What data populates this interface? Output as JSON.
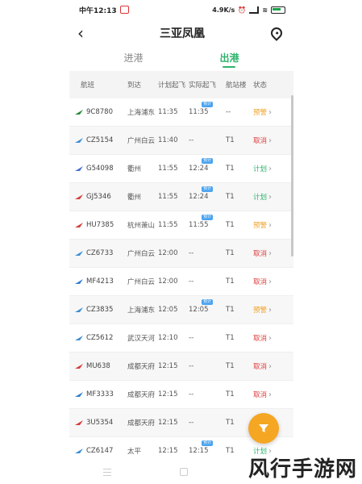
{
  "status_bar": {
    "time": "中午12:13",
    "speed": "4.9K/s",
    "battery_color": "#1aa34a"
  },
  "header": {
    "title": "三亚凤凰"
  },
  "tabs": [
    {
      "label": "进港",
      "active": false
    },
    {
      "label": "出港",
      "active": true
    }
  ],
  "table": {
    "headers": [
      "航班",
      "到达",
      "计划起飞",
      "实际起飞",
      "航站楼",
      "状态"
    ],
    "rows": [
      {
        "flight": "9C8780",
        "dest": "上海浦东",
        "plan": "11:35",
        "actual": "11:35",
        "tag": "预计",
        "terminal": "--",
        "status": "预警",
        "status_type": "pre",
        "logo_color": "#2a8a3a"
      },
      {
        "flight": "CZ5154",
        "dest": "广州白云",
        "plan": "11:40",
        "actual": "--",
        "tag": "",
        "terminal": "T1",
        "status": "取消",
        "status_type": "cancel",
        "logo_color": "#3b8fd6"
      },
      {
        "flight": "G54098",
        "dest": "衢州",
        "plan": "11:55",
        "actual": "12:24",
        "tag": "预计",
        "terminal": "T1",
        "status": "计划",
        "status_type": "plan",
        "logo_color": "#4a6fd6"
      },
      {
        "flight": "GJ5346",
        "dest": "衢州",
        "plan": "11:55",
        "actual": "12:24",
        "tag": "预计",
        "terminal": "T1",
        "status": "计划",
        "status_type": "plan",
        "logo_color": "#d63b3b"
      },
      {
        "flight": "HU7385",
        "dest": "杭州萧山",
        "plan": "11:55",
        "actual": "11:55",
        "tag": "预计",
        "terminal": "T1",
        "status": "预警",
        "status_type": "pre",
        "logo_color": "#d63b3b"
      },
      {
        "flight": "CZ6733",
        "dest": "广州白云",
        "plan": "12:00",
        "actual": "--",
        "tag": "",
        "terminal": "T1",
        "status": "取消",
        "status_type": "cancel",
        "logo_color": "#3b8fd6"
      },
      {
        "flight": "MF4213",
        "dest": "广州白云",
        "plan": "12:00",
        "actual": "--",
        "tag": "",
        "terminal": "T1",
        "status": "取消",
        "status_type": "cancel",
        "logo_color": "#2f7fd0"
      },
      {
        "flight": "CZ3835",
        "dest": "上海浦东",
        "plan": "12:05",
        "actual": "12:05",
        "tag": "预计",
        "terminal": "T1",
        "status": "预警",
        "status_type": "pre",
        "logo_color": "#3b8fd6"
      },
      {
        "flight": "CZ5612",
        "dest": "武汉天河",
        "plan": "12:10",
        "actual": "--",
        "tag": "",
        "terminal": "T1",
        "status": "取消",
        "status_type": "cancel",
        "logo_color": "#3b8fd6"
      },
      {
        "flight": "MU638",
        "dest": "成都天府",
        "plan": "12:15",
        "actual": "--",
        "tag": "",
        "terminal": "T1",
        "status": "取消",
        "status_type": "cancel",
        "logo_color": "#d63b3b"
      },
      {
        "flight": "MF3333",
        "dest": "成都天府",
        "plan": "12:15",
        "actual": "--",
        "tag": "",
        "terminal": "T1",
        "status": "取消",
        "status_type": "cancel",
        "logo_color": "#2f7fd0"
      },
      {
        "flight": "3U5354",
        "dest": "成都天府",
        "plan": "12:15",
        "actual": "--",
        "tag": "",
        "terminal": "T1",
        "status": "取消",
        "status_type": "cancel",
        "logo_color": "#d63b3b"
      },
      {
        "flight": "CZ6147",
        "dest": "太平",
        "plan": "12:15",
        "actual": "12:15",
        "tag": "预计",
        "terminal": "T1",
        "status": "计划",
        "status_type": "plan",
        "logo_color": "#3b8fd6"
      }
    ]
  },
  "accent_colors": {
    "active_tab": "#2db36c",
    "warning": "#f0a020",
    "cancelled": "#e03c3c",
    "planned": "#2db36c",
    "fab": "#f5a623"
  },
  "fab": {
    "icon": "filter-icon"
  },
  "watermark": "风行手游网"
}
